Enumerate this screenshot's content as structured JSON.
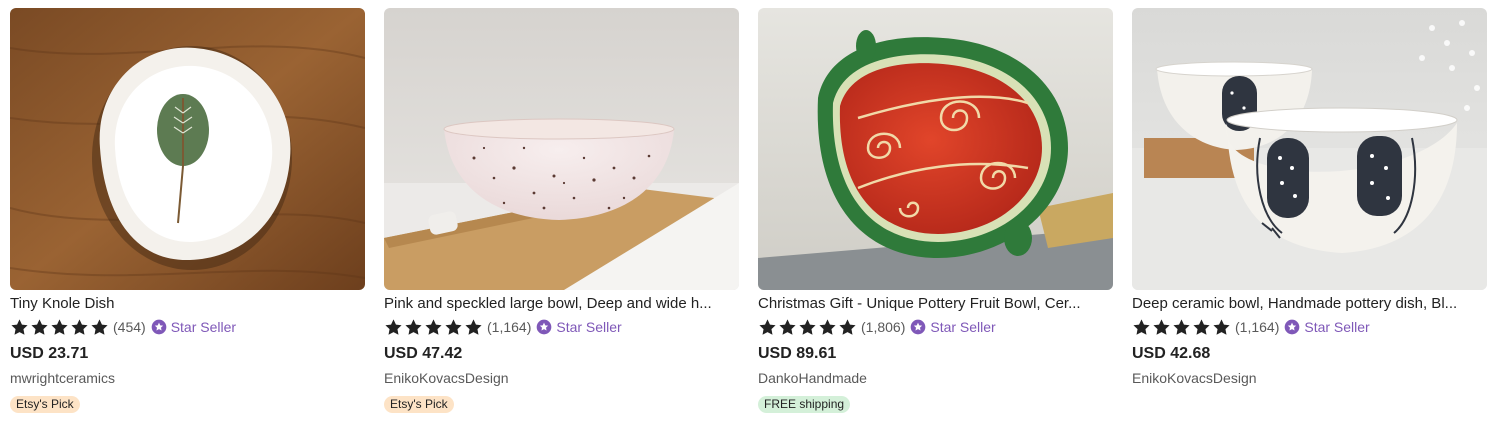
{
  "colors": {
    "star": "#222222",
    "star_seller": "#7f58b8",
    "pick_badge": "#fde3c6",
    "shipping_badge": "#d4f0d9"
  },
  "listings": [
    {
      "title": "Tiny Knole Dish",
      "rating": 5,
      "review_count": "(454)",
      "star_seller": "Star Seller",
      "price": "USD 23.71",
      "shop": "mwrightceramics",
      "badge": "Etsy's Pick"
    },
    {
      "title": "Pink and speckled large bowl, Deep and wide h...",
      "rating": 5,
      "review_count": "(1,164)",
      "star_seller": "Star Seller",
      "price": "USD 47.42",
      "shop": "EnikoKovacsDesign",
      "badge": "Etsy's Pick"
    },
    {
      "title": "Christmas Gift - Unique Pottery Fruit Bowl, Cer...",
      "rating": 5,
      "review_count": "(1,806)",
      "star_seller": "Star Seller",
      "price": "USD 89.61",
      "shop": "DankoHandmade",
      "badge": "FREE shipping"
    },
    {
      "title": "Deep ceramic bowl, Handmade pottery dish, Bl...",
      "rating": 5,
      "review_count": "(1,164)",
      "star_seller": "Star Seller",
      "price": "USD 42.68",
      "shop": "EnikoKovacsDesign"
    }
  ]
}
